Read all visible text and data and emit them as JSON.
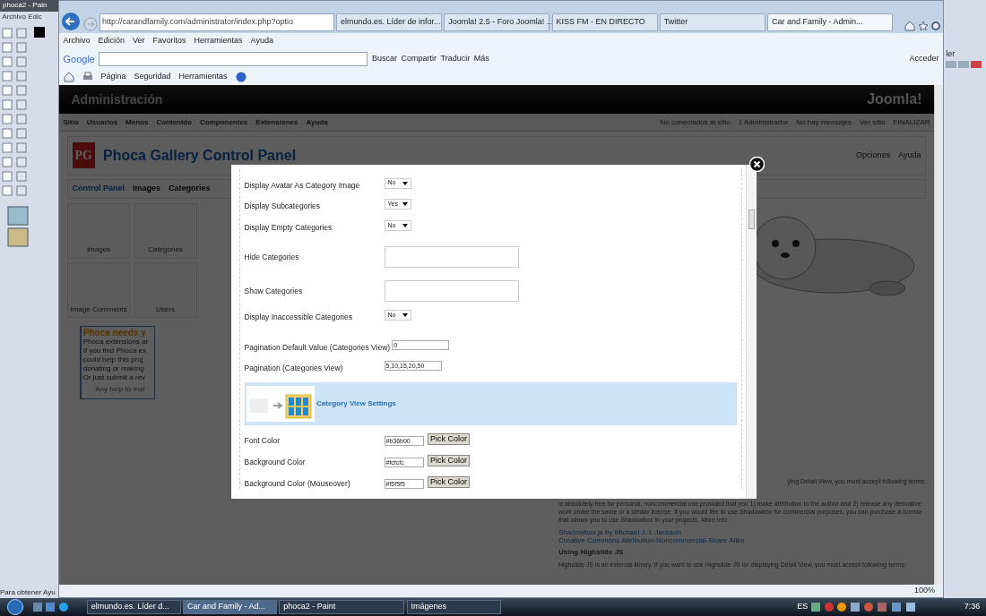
{
  "paint": {
    "title": "phoca2 - Pain",
    "menu": [
      "Archivo",
      "Edic"
    ],
    "right_label": "ler",
    "status": "Para obtener Ayu"
  },
  "browser": {
    "address": "http://carandfamily.com/administrator/index.php?optio",
    "tabs": [
      {
        "label": "elmundo.es. Líder de infor...",
        "selected": false
      },
      {
        "label": "Joomla! 2.5 - Foro Joomla! ...",
        "selected": false
      },
      {
        "label": "KISS FM - EN DIRECTO",
        "selected": false
      },
      {
        "label": "Twitter",
        "selected": false
      },
      {
        "label": "Car and Family - Admin...",
        "selected": true
      }
    ],
    "menu": [
      "Archivo",
      "Edición",
      "Ver",
      "Favoritos",
      "Herramientas",
      "Ayuda"
    ],
    "google_toolbar": {
      "brand": "Google",
      "items": [
        "Buscar",
        "Compartir",
        "Traducir",
        "Más"
      ],
      "signin": "Acceder"
    },
    "command_bar": [
      "Página",
      "Seguridad",
      "Herramientas"
    ],
    "zoom": "100%"
  },
  "admin": {
    "header": "Administración",
    "logo": "Joomla!",
    "menu": [
      "Sitio",
      "Usuarios",
      "Menús",
      "Contenido",
      "Componentes",
      "Extensiones",
      "Ayuda"
    ],
    "status_items": [
      "No conectados al sitio",
      "1 Administrador",
      "No hay mensajes",
      "Ver sitio",
      "FINALIZAR"
    ],
    "component_logo": "PG",
    "title": "Phoca Gallery Control Panel",
    "toolbar": [
      "Opciones",
      "Ayuda"
    ],
    "submenu": [
      {
        "label": "Control Panel",
        "selected": true
      },
      {
        "label": "Images",
        "selected": false
      },
      {
        "label": "Categories",
        "selected": false
      }
    ],
    "tiles": [
      "Images",
      "Categories",
      "Image Comments",
      "Users"
    ],
    "support_box": {
      "title": "Phoca needs y",
      "lines": [
        "Phoca extensions ar",
        "If you find Phoca ex",
        "could help this proj",
        "donating or making",
        "Or just submit a rev"
      ],
      "footer": "Any help to mai"
    },
    "info": [
      "ying Detail View, you must accept following terms:",
      "is absolutely free for personal, noncommercial use provided that you 1) make attribution to the author and 2) release any derivative work under the same or a similar license. If you would like to use Shadowbox for commercial purposes, you can purchase a license that allows you to use Shadowbox in your projects. More info"
    ],
    "credit": "Shadowbox.js by Michael J. I. Jackson",
    "license": "Creative Commons Attribution-Noncommercial-Share Alike",
    "subheading": "Using Highslide JS",
    "footnote": "Highslide JS is an external library. If you want to use Highslide JS for displaying Detail View, you must accept following terms:"
  },
  "modal": {
    "rows": [
      {
        "kind": "select",
        "label": "Display Avatar As Category Image",
        "value": "No"
      },
      {
        "kind": "select",
        "label": "Display Subcategories",
        "value": "Yes"
      },
      {
        "kind": "select",
        "label": "Display Empty Categories",
        "value": "No"
      },
      {
        "kind": "list",
        "label": "Hide Categories"
      },
      {
        "kind": "list",
        "label": "Show Categories"
      },
      {
        "kind": "select",
        "label": "Display Inaccessible Categories",
        "value": "No"
      },
      {
        "kind": "text",
        "label": "Pagination Default Value (Categories View)",
        "value": "0"
      },
      {
        "kind": "text",
        "label": "Pagination (Categories View)",
        "value": "5,10,15,20,50"
      },
      {
        "kind": "header",
        "label": "Category View Settings"
      },
      {
        "kind": "color",
        "label": "Font Color",
        "value": "#b36b00",
        "button": "Pick Color"
      },
      {
        "kind": "color",
        "label": "Background Color",
        "value": "#fcfcfc",
        "button": "Pick Color"
      },
      {
        "kind": "color",
        "label": "Background Color (Mouseover)",
        "value": "#f5f5f5",
        "button": "Pick Color"
      }
    ]
  },
  "taskbar": {
    "items": [
      {
        "label": "elmundo.es. Líder d...",
        "selected": false
      },
      {
        "label": "Car and Family - Ad...",
        "selected": true
      },
      {
        "label": "phoca2 - Paint",
        "selected": false
      },
      {
        "label": "Imágenes",
        "selected": false
      }
    ],
    "language": "ES",
    "clock": "7:36"
  }
}
